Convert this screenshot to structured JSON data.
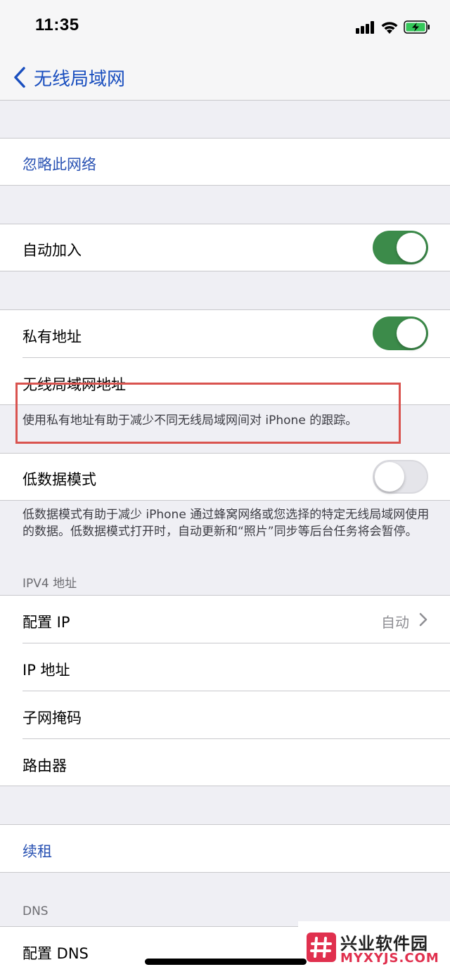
{
  "status": {
    "time": "11:35"
  },
  "nav": {
    "back_label": "无线局域网"
  },
  "forget": {
    "label": "忽略此网络"
  },
  "auto_join": {
    "label": "自动加入",
    "enabled": true
  },
  "private_address": {
    "label": "私有地址",
    "enabled": true,
    "wifi_address_label": "无线局域网地址",
    "footnote": "使用私有地址有助于减少不同无线局域网间对 iPhone 的跟踪。"
  },
  "low_data": {
    "label": "低数据模式",
    "enabled": false,
    "footnote": "低数据模式有助于减少 iPhone 通过蜂窝网络或您选择的特定无线局域网使用的数据。低数据模式打开时，自动更新和“照片”同步等后台任务将会暂停。"
  },
  "ipv4": {
    "header": "IPV4 地址",
    "configure_ip_label": "配置 IP",
    "configure_ip_value": "自动",
    "ip_address_label": "IP 地址",
    "subnet_label": "子网掩码",
    "router_label": "路由器"
  },
  "renew": {
    "label": "续租"
  },
  "dns": {
    "header": "DNS",
    "configure_label": "配置 DNS"
  },
  "watermark": {
    "title": "兴业软件园",
    "url": "MYXYJS.COM"
  },
  "colors": {
    "accent": "#2952b3",
    "toggle_on": "#3c8b4a",
    "highlight": "#d9534f"
  }
}
